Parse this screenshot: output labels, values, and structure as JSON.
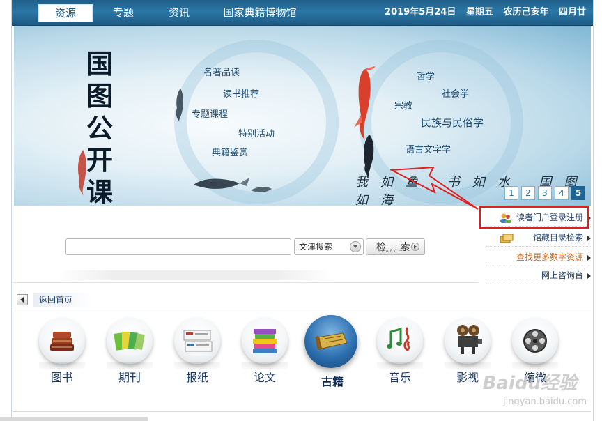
{
  "nav": {
    "tabs": [
      "资源",
      "专题",
      "资讯",
      "国家典籍博物馆"
    ],
    "active_tab": 0
  },
  "datebar": {
    "date": "2019年5月24日",
    "weekday": "星期五",
    "lunar_year": "农历己亥年",
    "lunar_day": "四月廿"
  },
  "banner": {
    "title_chars": [
      "国",
      "图",
      "公",
      "开",
      "课"
    ],
    "left_links": [
      "名著品读",
      "读书推荐",
      "专题课程",
      "特别活动",
      "典籍鉴赏"
    ],
    "right_links": [
      "哲学",
      "社会学",
      "宗教",
      "民族与民俗学",
      "语言文字学"
    ],
    "slogan": "我如鱼 书如水 国图如海",
    "pages": [
      "1",
      "2",
      "3",
      "4",
      "5"
    ],
    "active_page": 4
  },
  "search": {
    "value": "",
    "scope": "文津搜索",
    "button_cn": "检 索",
    "button_en": "SEARCH"
  },
  "right_links": [
    {
      "label": "读者门户登录注册",
      "color": "#1f3f6a"
    },
    {
      "label": "馆藏目录检索",
      "color": "#1f3f6a"
    },
    {
      "label": "查找更多数字资源",
      "color": "#d2691e"
    },
    {
      "label": "网上咨询台",
      "color": "#1f3f6a"
    }
  ],
  "back_home": "返回首页",
  "categories": [
    {
      "label": "图书",
      "icon": "books-icon"
    },
    {
      "label": "期刊",
      "icon": "magazines-icon"
    },
    {
      "label": "报纸",
      "icon": "newspapers-icon"
    },
    {
      "label": "论文",
      "icon": "theses-icon"
    },
    {
      "label": "古籍",
      "icon": "scroll-icon",
      "active": true
    },
    {
      "label": "音乐",
      "icon": "music-notes-icon"
    },
    {
      "label": "影视",
      "icon": "film-projector-icon"
    },
    {
      "label": "缩微",
      "icon": "film-reel-icon"
    }
  ],
  "watermark": {
    "main": "Baidu经验",
    "sub": "jingyan.baidu.com"
  },
  "colors": {
    "nav_blue": "#2b77a6",
    "highlight_red": "#e02020",
    "orange_link": "#d2691e"
  }
}
